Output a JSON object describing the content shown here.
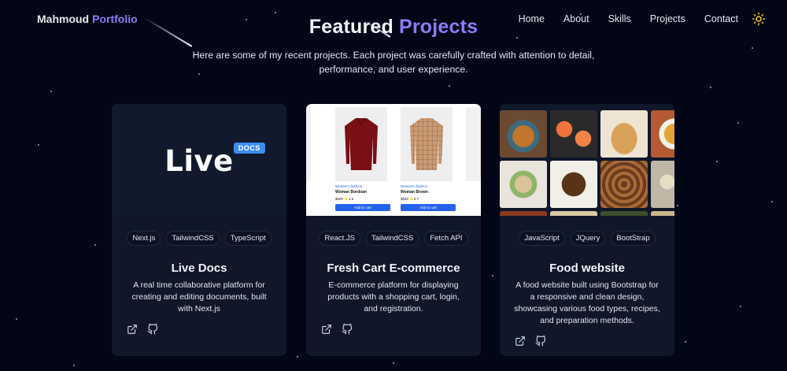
{
  "navbar": {
    "brand_first": "Mahmoud",
    "brand_second": "Portfolio",
    "links": [
      "Home",
      "About",
      "Skills",
      "Projects",
      "Contact"
    ],
    "theme_icon": "sun-icon"
  },
  "hero": {
    "title_first": "Featured",
    "title_second": "Projects",
    "subtitle": "Here are some of my recent projects. Each project was carefully crafted with attention to detail, performance, and user experience."
  },
  "projects": [
    {
      "image_text": "Live",
      "image_badge": "DOCS",
      "tags": [
        "Next.js",
        "TailwindCSS",
        "TypeScript"
      ],
      "title": "Live Docs",
      "description": "A real time collaborative platform for creating and editing documents, built with Next.js",
      "links": [
        "external-link-icon",
        "github-icon"
      ]
    },
    {
      "image_products": [
        {
          "category": "Women's fashion",
          "name": "Woman Bordoan",
          "price": "$200 ⭐4.5",
          "button": "Add to cart"
        },
        {
          "category": "Women's fashion",
          "name": "Woman Brown",
          "price": "$250 ⭐4.7",
          "button": "Add to cart"
        }
      ],
      "tags": [
        "React.JS",
        "TailwindCSS",
        "Fetch API"
      ],
      "title": "Fresh Cart E-commerce",
      "description": "E-commerce platform for displaying products with a shopping cart, login, and registration.",
      "links": [
        "external-link-icon",
        "github-icon"
      ]
    },
    {
      "tags": [
        "JavaScript",
        "JQuery",
        "BootStrap"
      ],
      "title": "Food website",
      "description": "A food website built using Bootstrap for a responsive and clean design, showcasing various food types, recipes, and preparation methods.",
      "links": [
        "external-link-icon",
        "github-icon"
      ]
    }
  ],
  "colors": {
    "background": "#020617",
    "card": "#0f1729",
    "accent": "#8b7cf6",
    "text": "#e5e7eb",
    "theme_icon": "#facc15"
  }
}
